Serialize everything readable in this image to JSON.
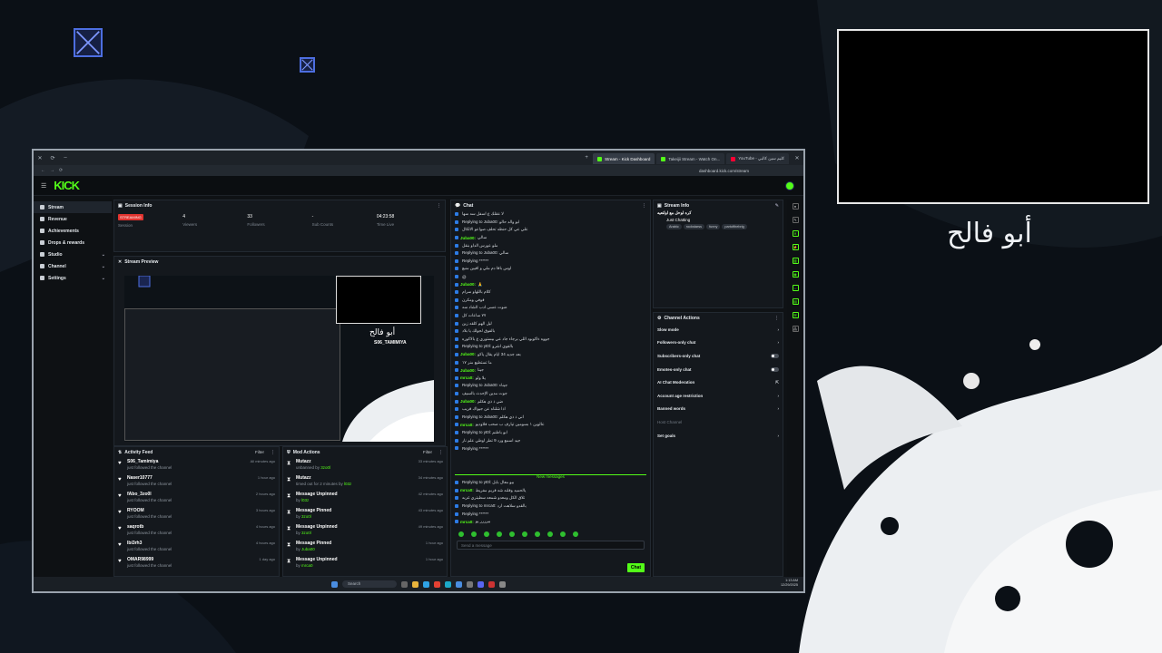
{
  "overlay": {
    "streamer_name": "أبو فالح"
  },
  "browser": {
    "tabs": [
      {
        "label": "Stream - Kick Dashboard",
        "active": true
      },
      {
        "label": "Takeijii Stream - Watch On...",
        "active": false
      },
      {
        "label": "YouTube - كليم سين كالبي",
        "active": false
      }
    ],
    "url": "dashboard.kick.com/stream"
  },
  "kick": {
    "logo": "KICK"
  },
  "sidebar": {
    "items": [
      {
        "label": "Stream",
        "active": true,
        "has_chevron": false
      },
      {
        "label": "Revenue",
        "active": false,
        "has_chevron": false
      },
      {
        "label": "Achievements",
        "active": false,
        "has_chevron": false
      },
      {
        "label": "Drops & rewards",
        "active": false,
        "has_chevron": false
      },
      {
        "label": "Studio",
        "active": false,
        "has_chevron": true
      },
      {
        "label": "Channel",
        "active": false,
        "has_chevron": true
      },
      {
        "label": "Settings",
        "active": false,
        "has_chevron": true
      }
    ]
  },
  "session": {
    "title": "Session Info",
    "live_badge": "STREAMING",
    "stats": [
      {
        "value": "4",
        "label": "Viewers"
      },
      {
        "value": "33",
        "label": "Followers"
      },
      {
        "value": "-",
        "label": "Sub Counts"
      },
      {
        "value": "04:23:58",
        "label": "Time Live"
      }
    ],
    "session_label": "Session"
  },
  "preview": {
    "title": "Stream Preview",
    "name": "أبو فالح",
    "username": "S06_TAMIMIYA"
  },
  "activity": {
    "title": "Activity Feed",
    "filter": "Filter",
    "rows": [
      {
        "name": "S06_Tamimiya",
        "sub": "just followed the channel",
        "time": "All minutes ago"
      },
      {
        "name": "Naser10777",
        "sub": "just followed the channel",
        "time": "1 hour ago"
      },
      {
        "name": "fAbo_3zo0l",
        "sub": "just followed the channel",
        "time": "2 hours ago"
      },
      {
        "name": "RYOOM",
        "sub": "just followed the channel",
        "time": "3 hours ago"
      },
      {
        "name": "saqrotb",
        "sub": "just followed the channel",
        "time": "4 hours ago"
      },
      {
        "name": "lbi3rh3",
        "sub": "just followed the channel",
        "time": "4 hours ago"
      },
      {
        "name": "OMAR98999",
        "sub": "just followed the channel",
        "time": "1 day ago"
      }
    ]
  },
  "mod": {
    "title": "Mod Actions",
    "filter": "Filter",
    "rows": [
      {
        "name": "Mutazz",
        "sub": "unbanned by ",
        "by": "3zo0l",
        "time": "33 minutes ago"
      },
      {
        "name": "Mutazz",
        "sub": "timed out for 2 minutes by ",
        "by": "l03z",
        "time": "34 minutes ago"
      },
      {
        "name": "Message Unpinned",
        "sub": "by ",
        "by": "l03z",
        "time": "42 minutes ago"
      },
      {
        "name": "Message Pinned",
        "sub": "by ",
        "by": "3zo0l",
        "time": "43 minutes ago"
      },
      {
        "name": "Message Unpinned",
        "sub": "by ",
        "by": "3zo0l",
        "time": "49 minutes ago"
      },
      {
        "name": "Message Pinned",
        "sub": "by ",
        "by": "Juba00",
        "time": "1 hour ago"
      },
      {
        "name": "Message Unpinned",
        "sub": "by ",
        "by": "mrca0",
        "time": "1 hour ago"
      }
    ]
  },
  "chat": {
    "title": "Chat",
    "new_messages": "New messages",
    "placeholder": "Send a message",
    "send_label": "Chat",
    "lines": [
      {
        "user": "",
        "color": "#e54",
        "text": "لا عقلك ع اسفل سه سها"
      },
      {
        "user": "",
        "color": "#6f7780",
        "text": "Replying to Juba00: ابو والد حالو"
      },
      {
        "user": "",
        "color": "#e54",
        "text": "علي عي كل حنظه تحلف صواعو الالكال"
      },
      {
        "user": "Juba00:",
        "color": "#53fc18",
        "text": "سالي"
      },
      {
        "user": "",
        "color": "#e54",
        "text": "ملو عورس الداو بنقل"
      },
      {
        "user": "",
        "color": "#6f7780",
        "text": "Replying to Juba00: سالي"
      },
      {
        "user": "",
        "color": "#e54",
        "text": "Replying ******"
      },
      {
        "user": "",
        "color": "#e54",
        "text": "اوس باقا دم ملي و اقبين منبع"
      },
      {
        "user": "",
        "color": "#e54",
        "text": "@"
      },
      {
        "user": "Juba00:",
        "color": "#53fc18",
        "text": "🙏"
      },
      {
        "user": "",
        "color": "#e54",
        "text": "كلام باللهاو سرام"
      },
      {
        "user": "",
        "color": "#e54",
        "text": "قوفي ومكرن"
      },
      {
        "user": "",
        "color": "#e54",
        "text": "ضوت عسى ادب الشاد سه"
      },
      {
        "user": "",
        "color": "#e54",
        "text": "٧٧ ساعات كل"
      },
      {
        "user": "",
        "color": "#e54",
        "text": "ليل الهم كلقه زين"
      },
      {
        "user": "",
        "color": "#e54",
        "text": "بالفوق لجولك يا بلاد"
      },
      {
        "user": "",
        "color": "#e54",
        "text": "جووه ءاكوبود اللي برجاء جاد عي بيستوري ع بالاكوره"
      },
      {
        "user": "",
        "color": "#6f7780",
        "text": "Replying to yt0l: بالقوي اشرو"
      },
      {
        "user": "Juba00:",
        "color": "#53fc18",
        "text": "بعد جديد 34 ايام يقال ياكو"
      },
      {
        "user": "",
        "color": "#e54",
        "text": "ما تستطيع منر ١٧"
      },
      {
        "user": "Juba00:",
        "color": "#53fc18",
        "text": "جينا"
      },
      {
        "user": "mrca0:",
        "color": "#53fc18",
        "text": "يلا ولو"
      },
      {
        "user": "",
        "color": "#6f7780",
        "text": "Replying to Juba00: جيناء"
      },
      {
        "user": "",
        "color": "#e54",
        "text": "جوت مدين الإحدث بالسيف"
      },
      {
        "user": "Juba00:",
        "color": "#53fc18",
        "text": "ضي ذ ذي هكلم"
      },
      {
        "user": "",
        "color": "#e54",
        "text": "اذا شلناه عن جيواك قريب"
      },
      {
        "user": "",
        "color": "#6f7780",
        "text": "Replying to Juba00: اني ذ ذي هكلم"
      },
      {
        "user": "mrca0:",
        "color": "#53fc18",
        "text": "عالوين ١ بسومين تيارف ب صحب فلاوديو"
      },
      {
        "user": "",
        "color": "#6f7780",
        "text": "Replying to yt0l: ابو باطنم"
      },
      {
        "user": "",
        "color": "#e54",
        "text": "جيد اسمع ورد 9 تطر اوطي علم نار"
      },
      {
        "user": "",
        "color": "#e54",
        "text": "Replying ******"
      }
    ],
    "lines_after": [
      {
        "user": "",
        "color": "#6f7780",
        "text": "Replying to yt0l: بيو معال بابل"
      },
      {
        "user": "mrca0:",
        "color": "#53fc18",
        "text": "يالحميد وقلنه شه قربم مفريط"
      },
      {
        "user": "",
        "color": "#e54",
        "text": "تلاق الكل ومعدو شمعه سطيتري غربه"
      },
      {
        "user": "",
        "color": "#6f7780",
        "text": "Replying to mrca0: بالقدو سلاهت ارد"
      },
      {
        "user": "",
        "color": "#e54",
        "text": "Replying ******"
      },
      {
        "user": "mrca0:",
        "color": "#53fc18",
        "text": "بيرررر يو"
      }
    ]
  },
  "streaminfo": {
    "title": "Stream Info",
    "stream_title": "كره لوحل مع اولتعيه",
    "category": "Just Chatting",
    "tags": [
      "Arabic",
      "rockstarss",
      "funny",
      "partofthebrig"
    ]
  },
  "chanactions": {
    "title": "Channel Actions",
    "items": [
      {
        "label": "Slow mode",
        "type": "chevron",
        "dim": false
      },
      {
        "label": "Followers-only chat",
        "type": "chevron",
        "dim": false
      },
      {
        "label": "Subscribers-only chat",
        "type": "toggle",
        "dim": false
      },
      {
        "label": "Emotes-only chat",
        "type": "toggle",
        "dim": false
      },
      {
        "label": "AI Chat Moderation",
        "type": "external",
        "dim": false
      },
      {
        "label": "Account age restriction",
        "type": "chevron",
        "dim": false
      },
      {
        "label": "Banned words",
        "type": "chevron",
        "dim": false
      },
      {
        "label": "Host Channel",
        "type": "none",
        "dim": true
      },
      {
        "label": "Set goals",
        "type": "chevron",
        "dim": false
      }
    ]
  },
  "taskbar": {
    "search": "Search",
    "time": "1:13 AM",
    "date": "12/29/2025"
  },
  "colors": {
    "accent": "#53fc18",
    "live": "#e0332f"
  }
}
